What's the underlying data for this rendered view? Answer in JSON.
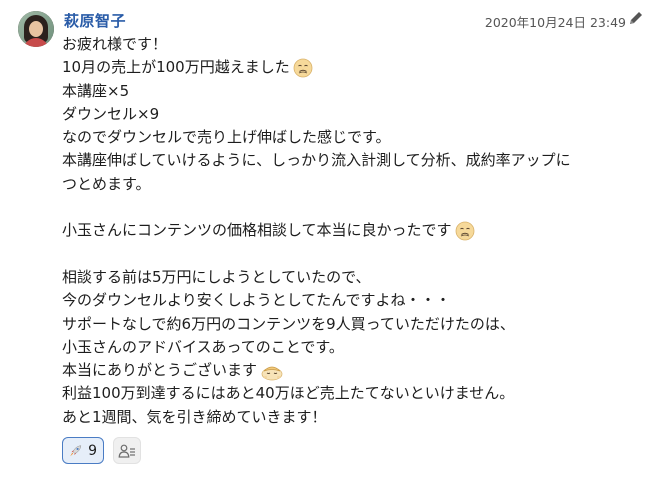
{
  "post": {
    "author": "萩原智子",
    "timestamp": "2020年10月24日 23:49",
    "lines": [
      "お疲れ様です！",
      "10月の売上が100万円越えました",
      "本講座×5",
      "ダウンセル×9",
      "なのでダウンセルで売り上げ伸ばした感じです。",
      "本講座伸ばしていけるように、しっかり流入計測して分析、成約率アップに",
      "つとめます。",
      "",
      "小玉さんにコンテンツの価格相談して本当に良かったです",
      "",
      "相談する前は5万円にしようとしていたので、",
      "今のダウンセルより安くしようとしてたんですよね・・・",
      "サポートなしで約6万円のコンテンツを9人買っていただけたのは、",
      "小玉さんのアドバイスあってのことです。",
      "本当にありがとうございます",
      "利益100万到達するにはあと40万ほど売上たてないといけません。",
      "あと1週間、気を引き締めていきます！"
    ]
  },
  "reactions": {
    "rocket_count": "9"
  },
  "icons": {
    "avatar": "user-photo",
    "edit": "pencil-icon",
    "emoji_1": "relieved-face-icon",
    "emoji_2": "relieved-face-icon",
    "emoji_3": "bowing-person-icon",
    "reaction": "rocket-icon",
    "add_reaction": "add-reaction-icon"
  },
  "colors": {
    "author": "#2a5ca8",
    "reaction_border": "#4a7cc4",
    "reaction_bg": "#e6eef9"
  }
}
